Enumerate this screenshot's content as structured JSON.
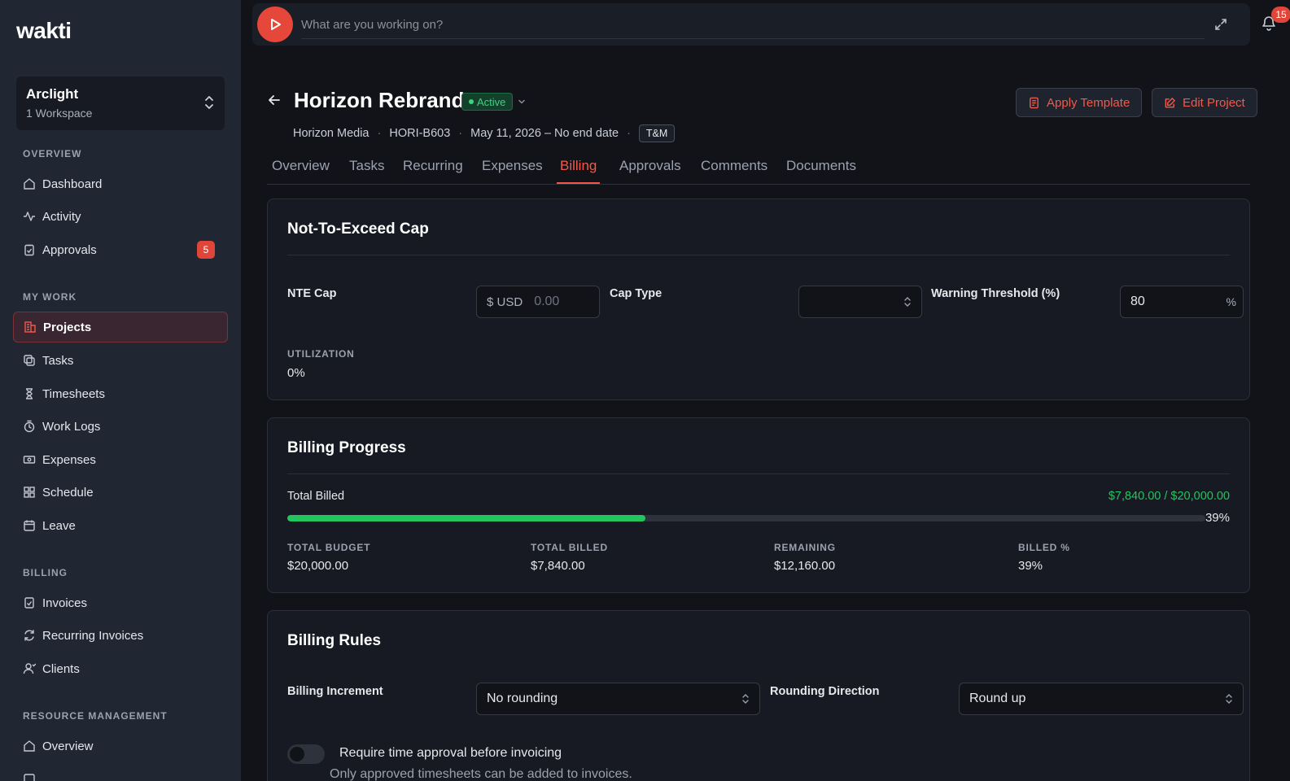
{
  "app": {
    "logo": "wakti"
  },
  "workspace": {
    "name": "Arclight",
    "subtitle": "1 Workspace"
  },
  "sidebar": {
    "overview_label": "OVERVIEW",
    "mywork_label": "MY WORK",
    "billing_label": "BILLING",
    "resource_label": "RESOURCE MANAGEMENT",
    "dashboard": "Dashboard",
    "activity": "Activity",
    "approvals": "Approvals",
    "approvals_count": "5",
    "projects": "Projects",
    "tasks": "Tasks",
    "timesheets": "Timesheets",
    "worklogs": "Work Logs",
    "expenses": "Expenses",
    "schedule": "Schedule",
    "leave": "Leave",
    "invoices": "Invoices",
    "recurring_invoices": "Recurring Invoices",
    "clients": "Clients",
    "rm_overview": "Overview"
  },
  "topbar": {
    "placeholder": "What are you working on?",
    "notification_count": "15"
  },
  "project": {
    "title": "Horizon Rebrand",
    "status": "Active",
    "client": "Horizon Media",
    "code": "HORI-B603",
    "dates": "May 11, 2026 – No end date",
    "type": "T&M",
    "apply_template": "Apply Template",
    "edit_project": "Edit Project"
  },
  "tabs": {
    "overview": "Overview",
    "tasks": "Tasks",
    "recurring": "Recurring",
    "expenses": "Expenses",
    "billing": "Billing",
    "approvals": "Approvals",
    "comments": "Comments",
    "documents": "Documents"
  },
  "nte": {
    "title": "Not-To-Exceed Cap",
    "cap_label": "NTE Cap",
    "currency": "$ USD",
    "cap_placeholder": "0.00",
    "cap_type_label": "Cap Type",
    "cap_type_value": "",
    "threshold_label": "Warning Threshold (%)",
    "threshold_value": "80",
    "threshold_suffix": "%",
    "utilization_label": "UTILIZATION",
    "utilization_value": "0%"
  },
  "billing_progress": {
    "title": "Billing Progress",
    "total_billed_label": "Total Billed",
    "amount_text": "$7,840.00 / $20,000.00",
    "percent": 39,
    "percent_text": "39%",
    "total_budget_label": "TOTAL BUDGET",
    "total_budget": "$20,000.00",
    "total_billed_caption": "TOTAL BILLED",
    "total_billed": "$7,840.00",
    "remaining_label": "REMAINING",
    "remaining": "$12,160.00",
    "billed_pct_label": "BILLED %",
    "billed_pct": "39%"
  },
  "billing_rules": {
    "title": "Billing Rules",
    "increment_label": "Billing Increment",
    "increment_value": "No rounding",
    "direction_label": "Rounding Direction",
    "direction_value": "Round up",
    "approval_toggle_label": "Require time approval before invoicing",
    "approval_toggle_on": false,
    "approval_toggle_desc": "Only approved timesheets can be added to invoices."
  },
  "colors": {
    "accent": "#ef5a4c",
    "success": "#22c55e",
    "sidebar_bg": "#212633",
    "page_bg": "#111318"
  }
}
